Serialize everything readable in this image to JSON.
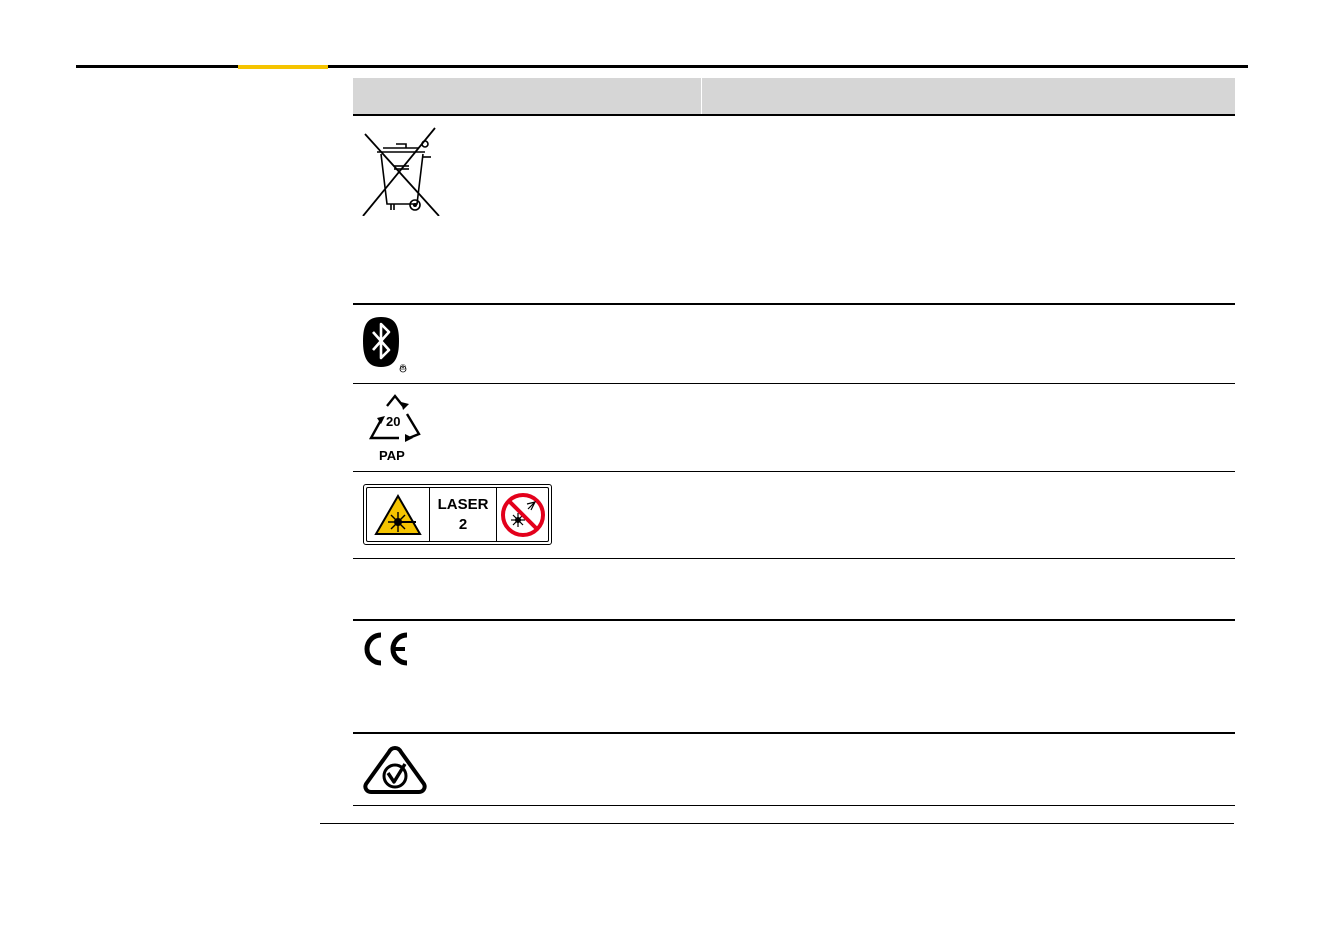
{
  "table": {
    "header": {
      "symbol": "",
      "description": ""
    },
    "rows": [
      {
        "icon": "weee-crossed-out-bin-icon",
        "description": ""
      },
      {
        "icon": "bluetooth-icon",
        "mark": "®",
        "description": ""
      },
      {
        "icon": "recycling-triangle-icon",
        "code": "20",
        "material": "PAP",
        "description": ""
      },
      {
        "icon": "laser-warning-label-icon",
        "label_line1": "LASER",
        "label_line2": "2",
        "description": ""
      },
      {
        "icon": "",
        "description": ""
      },
      {
        "icon": "ce-mark-icon",
        "description": ""
      },
      {
        "icon": "rcm-mark-icon",
        "description": ""
      }
    ]
  },
  "colors": {
    "accent": "#f5c400",
    "header_bg": "#d6d6d6",
    "laser_yellow": "#f5c400",
    "prohibit_red": "#e3001b"
  }
}
